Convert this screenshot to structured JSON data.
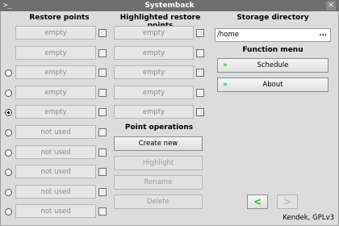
{
  "window": {
    "title": "Systemback",
    "terminal_glyph": ">_",
    "close_glyph": "✕"
  },
  "restore_points": {
    "header": "Restore points",
    "items": [
      {
        "label": "empty",
        "radio": false
      },
      {
        "label": "empty",
        "radio": false
      },
      {
        "label": "empty",
        "radio": true,
        "selected": false
      },
      {
        "label": "empty",
        "radio": true,
        "selected": false
      },
      {
        "label": "empty",
        "radio": true,
        "selected": true
      },
      {
        "label": "not used",
        "radio": true,
        "selected": false
      },
      {
        "label": "not used",
        "radio": true,
        "selected": false
      },
      {
        "label": "not used",
        "radio": true,
        "selected": false
      },
      {
        "label": "not used",
        "radio": true,
        "selected": false
      },
      {
        "label": "not used",
        "radio": true,
        "selected": false
      }
    ]
  },
  "highlighted": {
    "header": "Highlighted restore points",
    "items": [
      "empty",
      "empty",
      "empty",
      "empty",
      "empty"
    ]
  },
  "point_operations": {
    "header": "Point operations",
    "create_new": "Create new",
    "highlight": "Highlight",
    "rename": "Rename",
    "delete": "Delete"
  },
  "storage": {
    "header": "Storage directory",
    "path": "/home",
    "browse": "..."
  },
  "function_menu": {
    "header": "Function menu",
    "schedule": "Schedule",
    "about": "About"
  },
  "nav": {
    "back": "<",
    "forward": ">"
  },
  "footer": "Kendek, GPLv3",
  "colors": {
    "accent_green": "#22b522"
  }
}
